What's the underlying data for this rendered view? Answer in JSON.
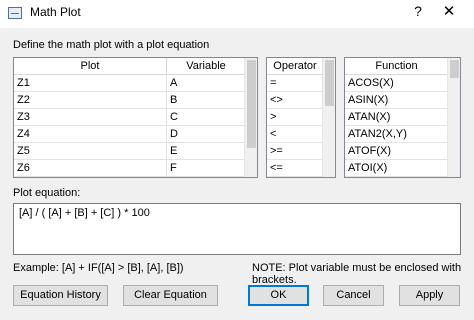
{
  "window": {
    "title": "Math Plot",
    "help_glyph": "?",
    "close_glyph": "✕"
  },
  "instructions": "Define the math plot with a plot equation",
  "plot_table": {
    "headers": [
      "Plot",
      "Variable"
    ],
    "rows": [
      [
        "Z1",
        "A"
      ],
      [
        "Z2",
        "B"
      ],
      [
        "Z3",
        "C"
      ],
      [
        "Z4",
        "D"
      ],
      [
        "Z5",
        "E"
      ],
      [
        "Z6",
        "F"
      ]
    ]
  },
  "operator_table": {
    "header": "Operator",
    "rows": [
      "=",
      "<>",
      ">",
      "<",
      ">=",
      "<="
    ]
  },
  "function_table": {
    "header": "Function",
    "rows": [
      "ACOS(X)",
      "ASIN(X)",
      "ATAN(X)",
      "ATAN2(X,Y)",
      "ATOF(X)",
      "ATOI(X)"
    ]
  },
  "equation": {
    "label": "Plot equation:",
    "value": "[A] / ( [A] + [B] + [C] ) * 100"
  },
  "example_text": "Example: [A] + IF([A] > [B], [A], [B])",
  "note_text": "NOTE: Plot variable must be enclosed with brackets.",
  "buttons": {
    "history": "Equation History",
    "clear": "Clear Equation",
    "ok": "OK",
    "cancel": "Cancel",
    "apply": "Apply"
  },
  "colors": {
    "dialog_bg": "#f0f0f0",
    "default_button_border": "#0078d7",
    "grid_border": "#828790"
  }
}
